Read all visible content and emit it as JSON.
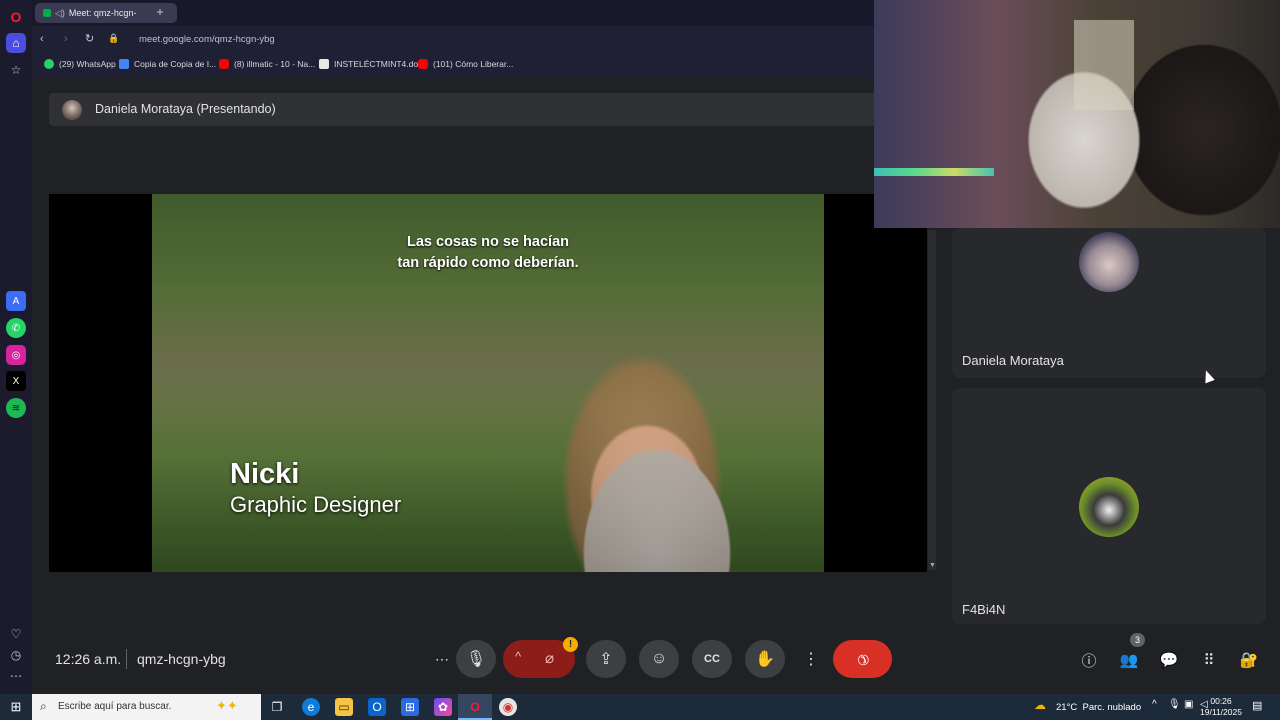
{
  "browser": {
    "tab_title": "Meet: qmz-hcgn-",
    "url": "meet.google.com/qmz-hcgn-ybg",
    "bookmarks": [
      {
        "label": "(29) WhatsApp",
        "color": "#25d366"
      },
      {
        "label": "Copia de Copia de I...",
        "color": "#4285f4"
      },
      {
        "label": "(8) illmatic - 10 - Na...",
        "color": "#ff0000"
      },
      {
        "label": "INSTELÉCTMINT4.doc",
        "color": "#e8e8e8"
      },
      {
        "label": "(101) Cómo Liberar...",
        "color": "#ff0000"
      }
    ]
  },
  "meet": {
    "presenter_label": "Daniela Morataya (Presentando)",
    "subtitle_line1": "Las cosas no se hacían",
    "subtitle_line2": "tan rápido como deberían.",
    "lower_third_name": "Nicki",
    "lower_third_role": "Graphic Designer",
    "participants": [
      {
        "name": "Daniela Morataya"
      },
      {
        "name": "F4Bi4N"
      }
    ],
    "time": "12:26 a.m.",
    "meeting_code": "qmz-hcgn-ybg",
    "participant_count": "3",
    "alert_badge": "!",
    "end_call_color": "#d93025",
    "camera_off_color": "#8c1d18"
  },
  "taskbar": {
    "search_placeholder": "Escribe aquí para buscar.",
    "weather": "21°C  Parc. nublado",
    "clock_time": "00:26",
    "clock_date": "19/11/2025"
  }
}
